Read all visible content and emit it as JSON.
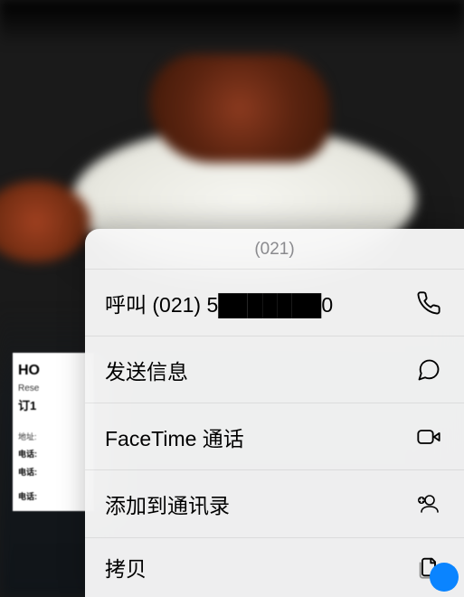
{
  "header": "(021)",
  "items": {
    "call": {
      "label": "呼叫 (021) 5███████0"
    },
    "message": {
      "label": "发送信息"
    },
    "facetime": {
      "label": "FaceTime 通话"
    },
    "addContact": {
      "label": "添加到通讯录"
    },
    "copy": {
      "label": "拷贝"
    }
  },
  "card": {
    "line1": "HO",
    "line2": "Rese",
    "line3": "订1",
    "addrLabel": "地址:",
    "phoneLabel": "电话:"
  }
}
